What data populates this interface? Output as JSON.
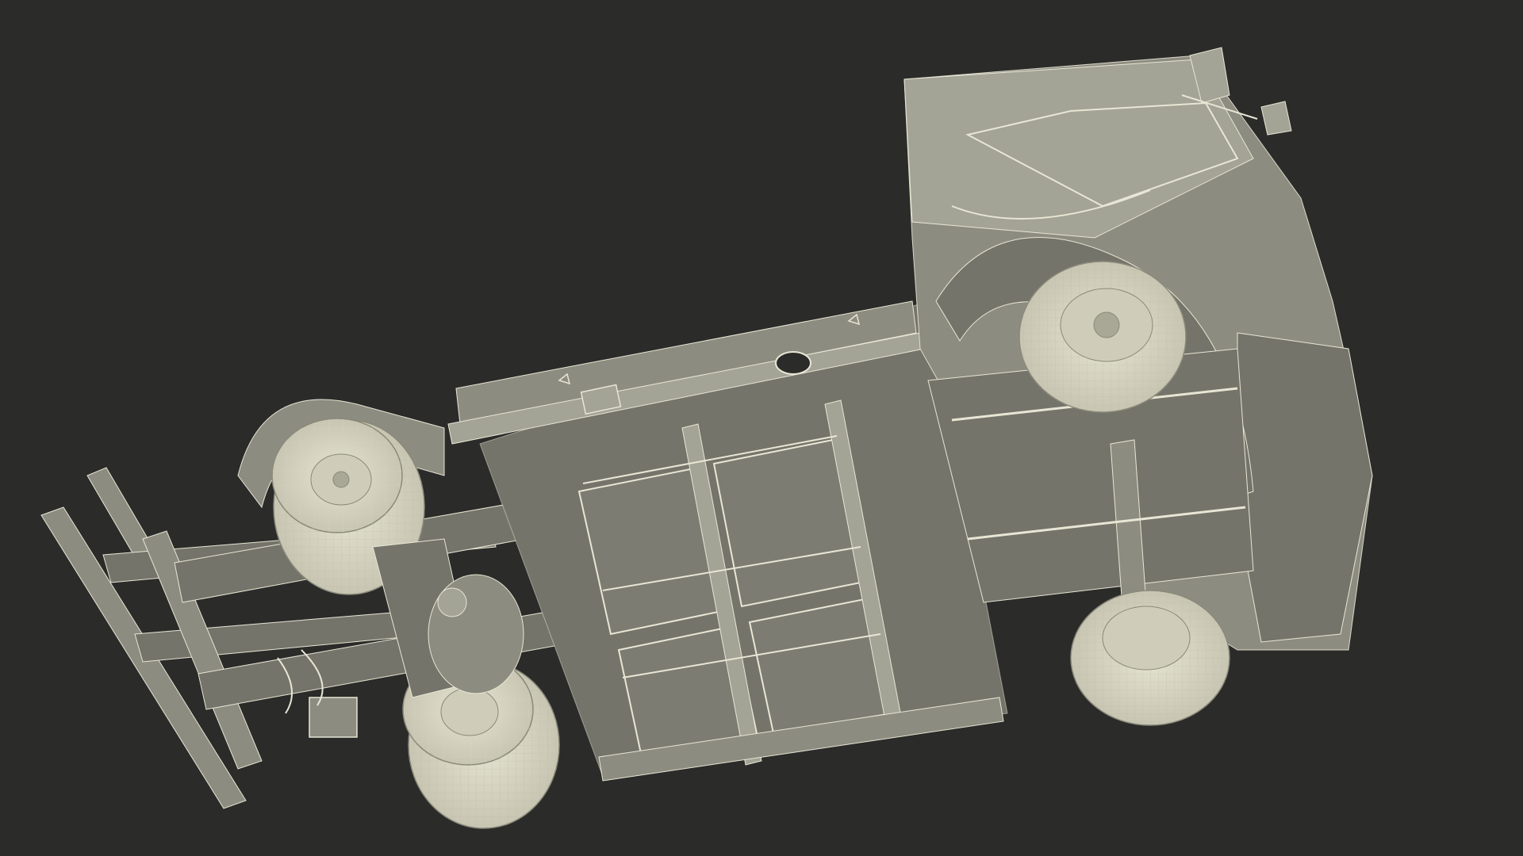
{
  "scene": {
    "background_color": "#2b2b2a",
    "model_surface_color": "#8c8c80",
    "wire_color": "#e8e6d4",
    "tire_color": "#d8d6c4"
  }
}
